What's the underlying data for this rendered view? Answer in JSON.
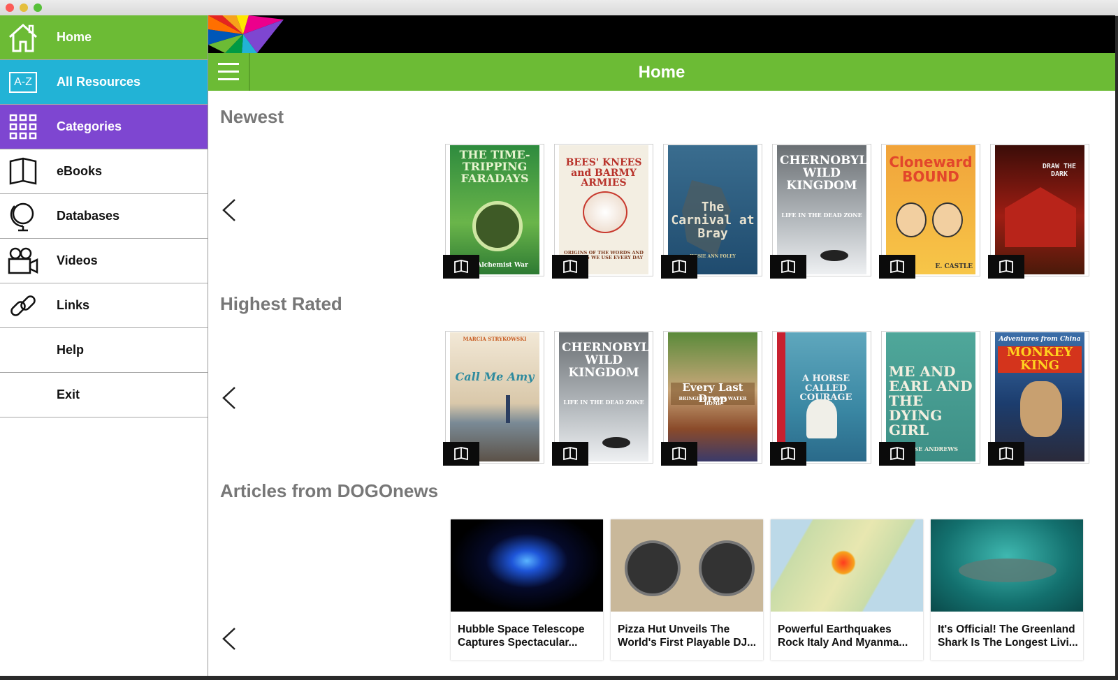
{
  "colors": {
    "home_green": "#6cbb35",
    "az_blue": "#22b3d6",
    "categories_purple": "#7e46d1",
    "section_gray": "#777777"
  },
  "sidebar": {
    "items": [
      {
        "label": "Home",
        "icon": "home-icon"
      },
      {
        "label": "All Resources",
        "icon": "a-z-icon",
        "icon_text": "A-Z"
      },
      {
        "label": "Categories",
        "icon": "grid-icon"
      },
      {
        "label": "eBooks",
        "icon": "book-icon"
      },
      {
        "label": "Databases",
        "icon": "globe-icon"
      },
      {
        "label": "Videos",
        "icon": "video-camera-icon"
      },
      {
        "label": "Links",
        "icon": "link-icon"
      },
      {
        "label": "Help",
        "icon": ""
      },
      {
        "label": "Exit",
        "icon": ""
      }
    ]
  },
  "header": {
    "title": "Home",
    "menu_icon": "hamburger-menu-icon",
    "logo": "rainbow-logo"
  },
  "sections": {
    "newest": {
      "title": "Newest",
      "books": [
        {
          "cover_text": "THE TIME-TRIPPING FARADAYS",
          "cover_sub": "The Alchemist War"
        },
        {
          "cover_text": "BEES' KNEES and BARMY ARMIES",
          "cover_sub": "ORIGINS OF THE WORDS AND PHRASES WE USE EVERY DAY"
        },
        {
          "cover_text": "The Carnival at Bray",
          "cover_sub": "JESSIE ANN FOLEY"
        },
        {
          "cover_text": "CHERNOBYL'S WILD KINGDOM",
          "cover_sub": "LIFE IN THE DEAD ZONE"
        },
        {
          "cover_text": "Cloneward BOUND",
          "cover_sub": "E. CASTLE"
        },
        {
          "cover_text": "DRAW THE DARK",
          "cover_sub": ""
        }
      ]
    },
    "highest_rated": {
      "title": "Highest Rated",
      "books": [
        {
          "cover_text": "Call Me Amy",
          "cover_sub": "MARCIA STRYKOWSKI"
        },
        {
          "cover_text": "CHERNOBYL'S WILD KINGDOM",
          "cover_sub": "LIFE IN THE DEAD ZONE"
        },
        {
          "cover_text": "Every Last Drop",
          "cover_sub": "BRINGING CLEAN WATER HOME"
        },
        {
          "cover_text": "A HORSE CALLED COURAGE",
          "cover_sub": ""
        },
        {
          "cover_text": "ME AND EARL AND THE DYING GIRL",
          "cover_sub": "JESSE ANDREWS"
        },
        {
          "cover_text": "MONKEY KING",
          "cover_sub": "Adventures from China"
        }
      ]
    },
    "articles": {
      "title": "Articles from DOGOnews",
      "items": [
        {
          "title": "Hubble Space Telescope Captures Spectacular..."
        },
        {
          "title": "Pizza Hut Unveils The World's First Playable DJ..."
        },
        {
          "title": "Powerful Earthquakes Rock Italy And Myanma..."
        },
        {
          "title": "It's Official! The Greenland Shark Is The Longest Livi..."
        }
      ]
    }
  }
}
